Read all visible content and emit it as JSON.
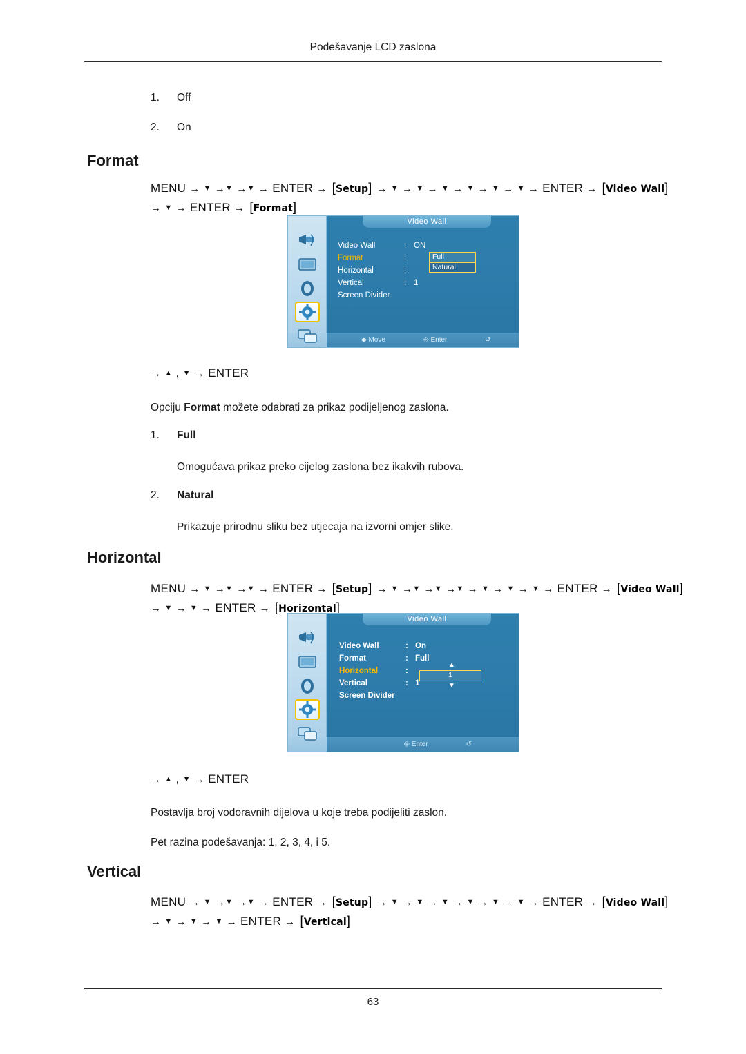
{
  "header": {
    "title": "Podešavanje LCD zaslona"
  },
  "footer": {
    "page_number": "63"
  },
  "top_list": {
    "items": [
      {
        "num": "1.",
        "label": "Off"
      },
      {
        "num": "2.",
        "label": "On"
      }
    ]
  },
  "sections": {
    "format": {
      "heading": "Format",
      "path_line1": "MENU → ▼ →▼ →▼ → ENTER → [Setup] → ▼ → ▼ → ▼ → ▼ → ▼ → ▼ → ENTER → [Video Wall]",
      "path_line2": "→ ▼ → ENTER → [Format]",
      "after_path": "→ ▲ , ▼ → ENTER",
      "description_prefix": "Opciju ",
      "description_bold": "Format",
      "description_suffix": " možete odabrati za prikaz podijeljenog zaslona.",
      "items": [
        {
          "num": "1.",
          "label": "Full",
          "desc": "Omogućava prikaz preko cijelog zaslona bez ikakvih rubova."
        },
        {
          "num": "2.",
          "label": "Natural",
          "desc": "Prikazuje prirodnu sliku bez utjecaja na izvorni omjer slike."
        }
      ],
      "osd": {
        "title": "Video Wall",
        "rows": [
          {
            "label": "Video Wall",
            "value": "ON",
            "highlighted": false
          },
          {
            "label": "Format",
            "value": "",
            "highlighted": true
          },
          {
            "label": "Horizontal",
            "value": "",
            "highlighted": false
          },
          {
            "label": "Vertical",
            "value": "1",
            "highlighted": false
          },
          {
            "label": "Screen Divider",
            "value": "",
            "highlighted": false
          }
        ],
        "popup_options": [
          "Full",
          "Natural"
        ],
        "footer_keys": [
          "Move",
          "Enter",
          "Return"
        ]
      }
    },
    "horizontal": {
      "heading": "Horizontal",
      "path_line1": "MENU → ▼ →▼ →▼ → ENTER → [Setup] → ▼ → ▼ → ▼ → ▼ → ▼ → ▼ → ▼ → ENTER → [Video Wall]",
      "path_line2": "→ ▼ → ▼ → ENTER → [Horizontal]",
      "after_path": "→ ▲ , ▼ → ENTER",
      "paragraphs": [
        "Postavlja broj vodoravnih dijelova u koje treba podijeliti zaslon.",
        "Pet razina podešavanja: 1, 2, 3, 4, i 5."
      ],
      "osd": {
        "title": "Video Wall",
        "rows": [
          {
            "label": "Video Wall",
            "value": "On",
            "highlighted": false
          },
          {
            "label": "Format",
            "value": "Full",
            "highlighted": false
          },
          {
            "label": "Horizontal",
            "value": "1",
            "highlighted": true
          },
          {
            "label": "Vertical",
            "value": "1",
            "highlighted": false
          },
          {
            "label": "Screen Divider",
            "value": "",
            "highlighted": false
          }
        ],
        "footer_keys": [
          "Enter",
          "Return"
        ]
      }
    },
    "vertical": {
      "heading": "Vertical",
      "path_line1": "MENU → ▼ →▼ →▼ → ENTER → [Setup] → ▼ → ▼ → ▼ → ▼ → ▼ → ▼ → ENTER → [Video Wall]",
      "path_line2": "→ ▼ → ▼ → ▼ → ENTER → [Vertical]"
    }
  }
}
